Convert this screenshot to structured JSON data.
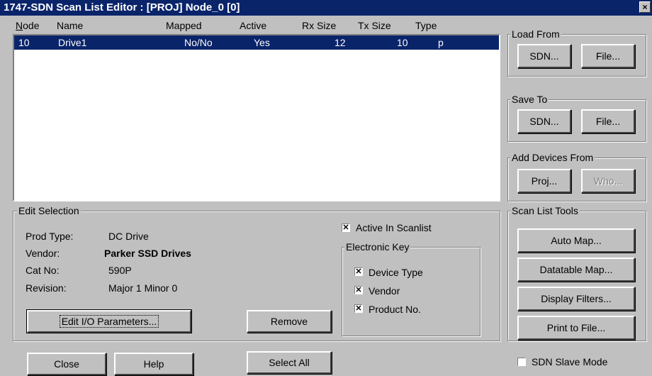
{
  "window": {
    "title": "1747-SDN Scan List Editor : [PROJ] Node_0 [0]",
    "close": "×"
  },
  "list": {
    "headers": [
      "Node",
      "Name",
      "Mapped",
      "Active",
      "Rx Size",
      "Tx Size",
      "Type"
    ],
    "rows": [
      {
        "node": "10",
        "name": "Drive1",
        "mapped": "No/No",
        "active": "Yes",
        "rx": "12",
        "tx": "10",
        "type": "p",
        "selected": true
      }
    ]
  },
  "edit_selection": {
    "label": "Edit Selection",
    "prod_type_label": "Prod Type:",
    "prod_type": "DC Drive",
    "vendor_label": "Vendor:",
    "vendor": "Parker SSD Drives",
    "catno_label": "Cat No:",
    "catno": "590P",
    "revision_label": "Revision:",
    "revision": "Major 1 Minor 0",
    "edit_io_button": "Edit I/O Parameters...",
    "remove_button": "Remove",
    "active_in_scanlist": "Active In Scanlist",
    "electronic_key_label": "Electronic Key",
    "device_type": "Device Type",
    "vendor_chk": "Vendor",
    "product_no": "Product No."
  },
  "bottom": {
    "close": "Close",
    "help": "Help",
    "select_all": "Select All",
    "slave_mode": "SDN Slave Mode"
  },
  "load_from": {
    "label": "Load From",
    "sdn": "SDN...",
    "file": "File..."
  },
  "save_to": {
    "label": "Save To",
    "sdn": "SDN...",
    "file": "File..."
  },
  "add_devices": {
    "label": "Add Devices From",
    "proj": "Proj...",
    "who": "Who..."
  },
  "tools": {
    "label": "Scan List Tools",
    "auto_map": "Auto Map...",
    "datatable_map": "Datatable Map...",
    "display_filters": "Display Filters...",
    "print": "Print to File..."
  },
  "colors": {
    "titlebar": "#0a246a",
    "selection": "#0a246a",
    "face": "#c0c0c0"
  }
}
